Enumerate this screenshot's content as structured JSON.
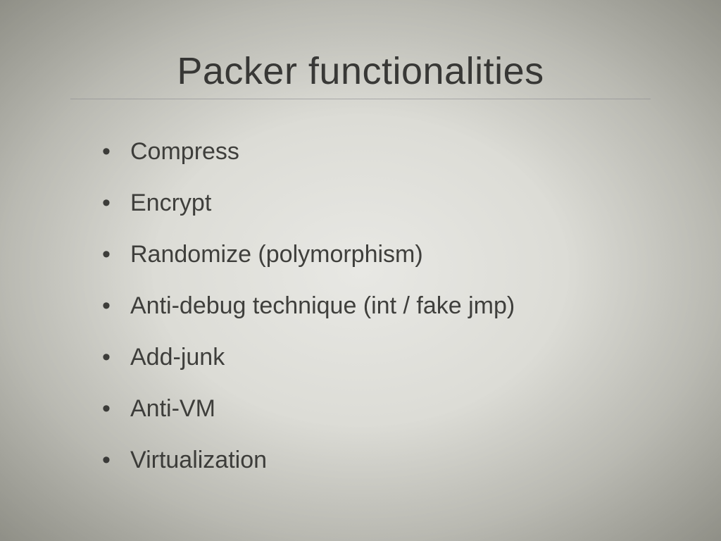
{
  "slide": {
    "title": "Packer functionalities",
    "bullets": [
      "Compress",
      "Encrypt",
      "Randomize (polymorphism)",
      "Anti-debug technique (int / fake jmp)",
      "Add-junk",
      "Anti-VM",
      "Virtualization"
    ]
  }
}
